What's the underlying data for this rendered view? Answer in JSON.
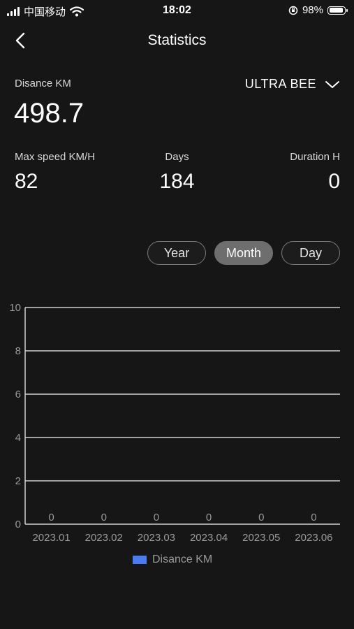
{
  "status": {
    "carrier": "中国移动",
    "time": "18:02",
    "battery": "98%"
  },
  "nav": {
    "title": "Statistics"
  },
  "summary": {
    "distance_label": "Disance KM",
    "distance_value": "498.7",
    "device": "ULTRA BEE",
    "max_speed_label": "Max speed KM/H",
    "max_speed_value": "82",
    "days_label": "Days",
    "days_value": "184",
    "duration_label": "Duration H",
    "duration_value": "0"
  },
  "period_tabs": [
    {
      "label": "Year",
      "active": false
    },
    {
      "label": "Month",
      "active": true
    },
    {
      "label": "Day",
      "active": false
    }
  ],
  "colors": {
    "series": "#4a7bf0",
    "grid": "#cfcfcf"
  },
  "chart_data": {
    "type": "bar",
    "categories": [
      "2023.01",
      "2023.02",
      "2023.03",
      "2023.04",
      "2023.05",
      "2023.06"
    ],
    "series": [
      {
        "name": "Disance KM",
        "values": [
          0,
          0,
          0,
          0,
          0,
          0
        ]
      }
    ],
    "ylim": [
      0,
      10
    ],
    "yticks": [
      0,
      2,
      4,
      6,
      8,
      10
    ],
    "grid": true,
    "legend": "bottom"
  }
}
